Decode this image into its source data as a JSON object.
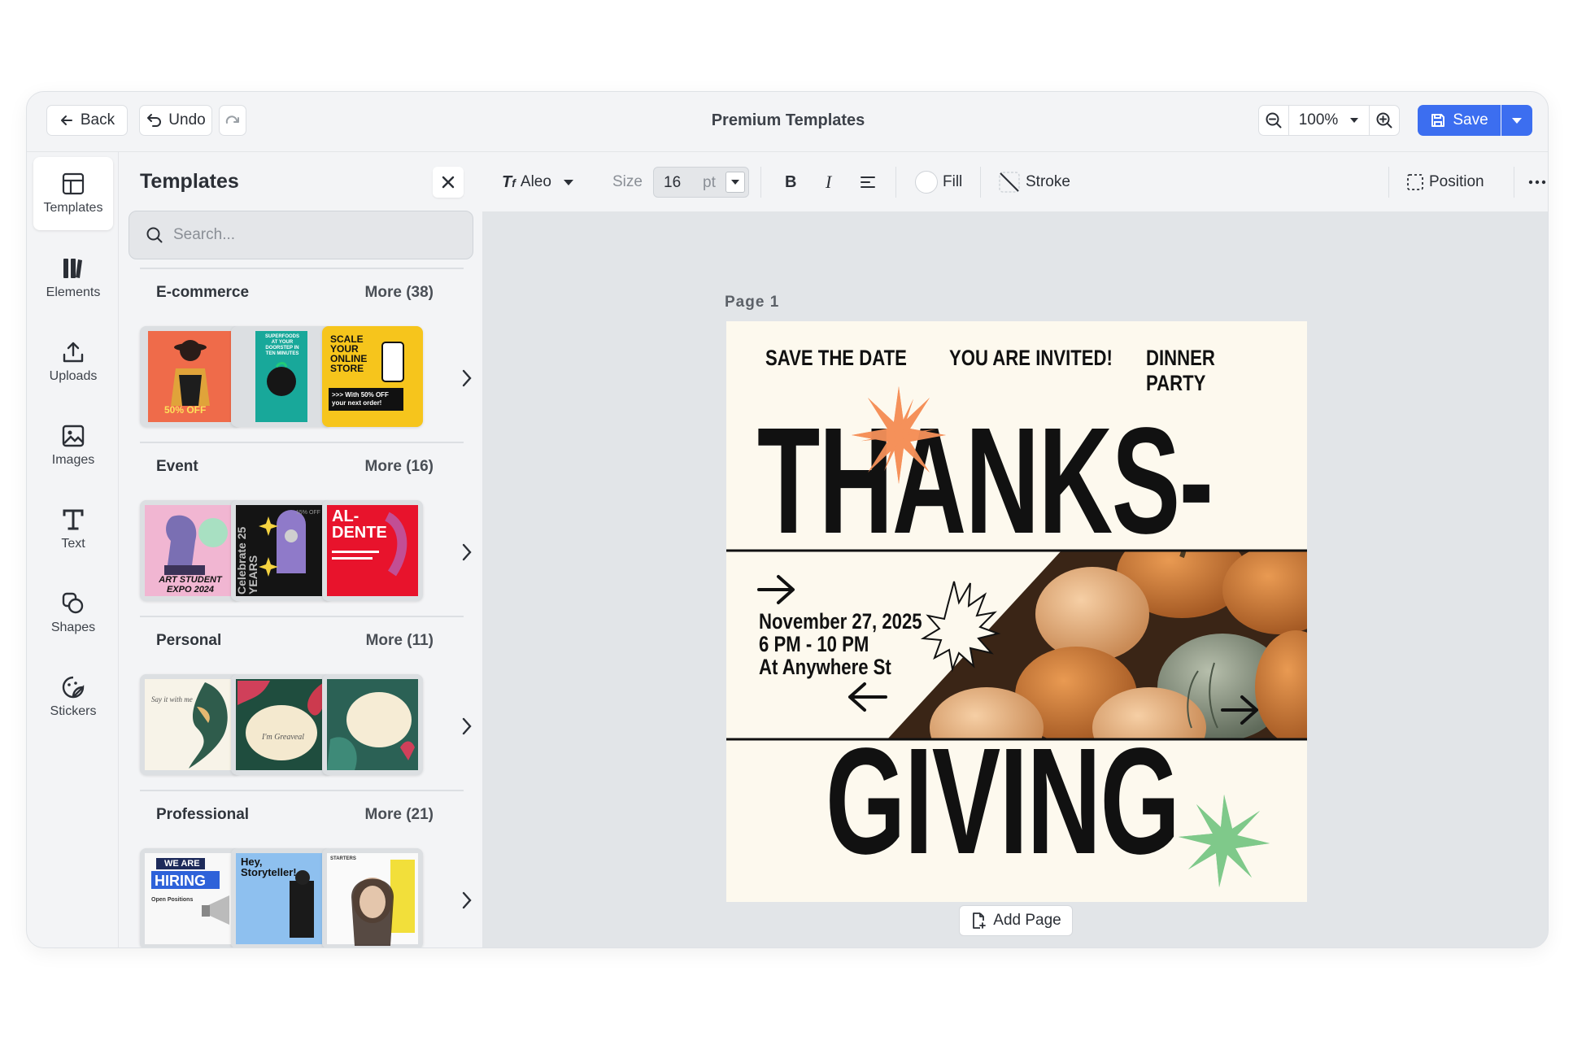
{
  "header": {
    "back_label": "Back",
    "undo_label": "Undo",
    "title": "Premium Templates",
    "zoom": "100%",
    "save_label": "Save"
  },
  "nav": {
    "items": [
      {
        "label": "Templates",
        "icon": "layout-icon"
      },
      {
        "label": "Elements",
        "icon": "elements-icon"
      },
      {
        "label": "Uploads",
        "icon": "upload-icon"
      },
      {
        "label": "Images",
        "icon": "image-icon"
      },
      {
        "label": "Text",
        "icon": "text-icon"
      },
      {
        "label": "Shapes",
        "icon": "shapes-icon"
      },
      {
        "label": "Stickers",
        "icon": "sticker-icon"
      }
    ]
  },
  "panel": {
    "title": "Templates",
    "search_placeholder": "Search...",
    "sections": [
      {
        "title": "E-commerce",
        "more": "More (38)"
      },
      {
        "title": "Event",
        "more": "More (16)"
      },
      {
        "title": "Personal",
        "more": "More (11)"
      },
      {
        "title": "Professional",
        "more": "More (21)"
      }
    ],
    "thumb_text": {
      "ecom1": "50% OFF",
      "ecom2": "SUPERFOODS AT YOUR DOORSTEP IN TEN MINUTES",
      "ecom3": "SCALE YOUR ONLINE STORE",
      "ecom3b": ">>> With 50% OFF your next order!",
      "event1": "ART STUDENT EXPO 2024",
      "event2": "Celebrate 25 YEARS",
      "event2b": "15% OFF",
      "event3": "AL- DENTE",
      "pers1": "Say it with me",
      "pers2": "I'm Greaveal",
      "prof1a": "WE ARE",
      "prof1b": "HIRING",
      "prof1c": "Open Positions",
      "prof2": "Hey, Storyteller!",
      "prof3": "STARTERS"
    }
  },
  "toolbar": {
    "font": "Aleo",
    "size_label": "Size",
    "size_value": "16",
    "size_unit": "pt",
    "bold": "B",
    "italic": "I",
    "fill_label": "Fill",
    "stroke_label": "Stroke",
    "position_label": "Position"
  },
  "canvas": {
    "page_label": "Page  1",
    "add_page_label": "Add Page"
  },
  "design": {
    "top1": "SAVE THE DATE",
    "top2": "YOU ARE INVITED!",
    "top3": "DINNER PARTY",
    "headline1": "THANKS-",
    "headline2": "GIVING",
    "date": "November 27, 2025",
    "time": "6 PM - 10 PM",
    "place": "At Anywhere St"
  },
  "colors": {
    "accent": "#3c6ef0",
    "page_bg": "#fdf9ee",
    "orange_star": "#f5915a",
    "green_star": "#7fc98a"
  }
}
